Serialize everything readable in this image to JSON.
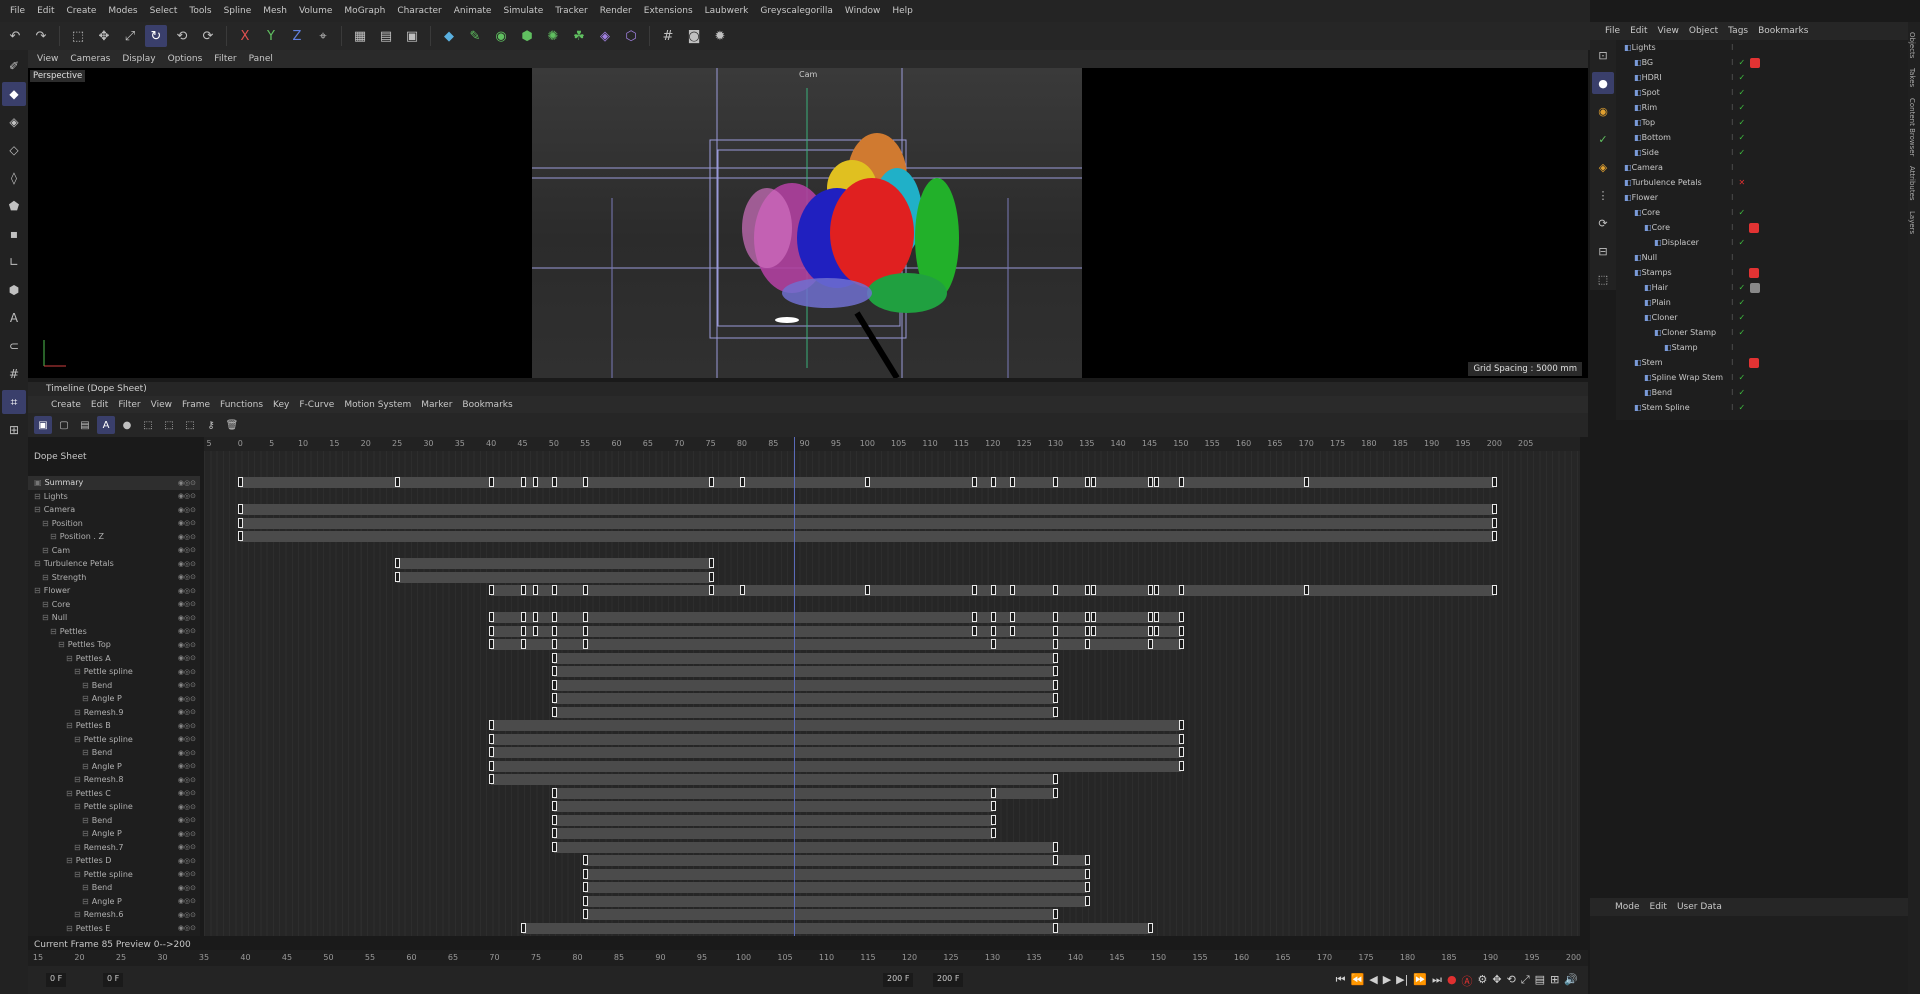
{
  "menu": [
    "File",
    "Edit",
    "Create",
    "Modes",
    "Select",
    "Tools",
    "Spline",
    "Mesh",
    "Volume",
    "MoGraph",
    "Character",
    "Animate",
    "Simulate",
    "Tracker",
    "Render",
    "Extensions",
    "Laubwerk",
    "Greyscalegorilla",
    "Window",
    "Help"
  ],
  "viewport": {
    "menu": [
      "View",
      "Cameras",
      "Display",
      "Options",
      "Filter",
      "Panel"
    ],
    "label": "Perspective",
    "camera_label": "Cam",
    "grid_spacing": "Grid Spacing : 5000 mm"
  },
  "timeline": {
    "title": "Timeline (Dope Sheet)",
    "menu": [
      "Create",
      "Edit",
      "Filter",
      "View",
      "Frame",
      "Functions",
      "Key",
      "F-Curve",
      "Motion System",
      "Marker",
      "Bookmarks"
    ],
    "dope_sheet_label": "Dope Sheet",
    "ruler": [
      "5",
      "0",
      "5",
      "10",
      "15",
      "20",
      "25",
      "30",
      "35",
      "40",
      "45",
      "50",
      "55",
      "60",
      "65",
      "70",
      "75",
      "80",
      "85",
      "90",
      "95",
      "100",
      "105",
      "110",
      "115",
      "120",
      "125",
      "130",
      "135",
      "140",
      "145",
      "150",
      "155",
      "160",
      "165",
      "170",
      "175",
      "180",
      "185",
      "190",
      "195",
      "200",
      "205"
    ],
    "playhead_frame": "85",
    "tracks": [
      "Summary",
      "Lights",
      "Camera",
      "Position",
      "Position . Z",
      "Cam",
      "Turbulence Petals",
      "Strength",
      "Flower",
      "Core",
      "Null",
      "Pettles",
      "Pettles Top",
      "Pettles A",
      "Pettle spline",
      "Bend",
      "Angle P",
      "Remesh.9",
      "Pettles B",
      "Pettle spline",
      "Bend",
      "Angle P",
      "Remesh.8",
      "Pettles C",
      "Pettle spline",
      "Bend",
      "Angle P",
      "Remesh.7",
      "Pettles D",
      "Pettle spline",
      "Bend",
      "Angle P",
      "Remesh.6",
      "Pettles E"
    ],
    "current_frame_label": "Current Frame  85  Preview  0-->200",
    "bottom_ruler": [
      "15",
      "20",
      "25",
      "30",
      "35",
      "40",
      "45",
      "50",
      "55",
      "60",
      "65",
      "70",
      "75",
      "80",
      "85",
      "90",
      "95",
      "100",
      "105",
      "110",
      "115",
      "120",
      "125",
      "130",
      "135",
      "140",
      "145",
      "150",
      "155",
      "160",
      "165",
      "170",
      "175",
      "180",
      "185",
      "190",
      "195",
      "200"
    ],
    "frame_start": "0 F",
    "frame_start2": "0 F",
    "frame_end": "200 F",
    "frame_end2": "200 F"
  },
  "object_manager": {
    "menu": [
      "File",
      "Edit",
      "View",
      "Object",
      "Tags",
      "Bookmarks"
    ],
    "objects": [
      {
        "name": "Lights",
        "indent": 0,
        "check": false
      },
      {
        "name": "BG",
        "indent": 1,
        "check": true,
        "tag": "#e23333"
      },
      {
        "name": "HDRI",
        "indent": 1,
        "check": true
      },
      {
        "name": "Spot",
        "indent": 1,
        "check": true
      },
      {
        "name": "Rim",
        "indent": 1,
        "check": true
      },
      {
        "name": "Top",
        "indent": 1,
        "check": true
      },
      {
        "name": "Bottom",
        "indent": 1,
        "check": true
      },
      {
        "name": "Side",
        "indent": 1,
        "check": true
      },
      {
        "name": "Camera",
        "indent": 0,
        "check": false
      },
      {
        "name": "Turbulence Petals",
        "indent": 0,
        "check": false,
        "cross": true
      },
      {
        "name": "Flower",
        "indent": 0,
        "check": false
      },
      {
        "name": "Core",
        "indent": 1,
        "check": true
      },
      {
        "name": "Core",
        "indent": 2,
        "check": false,
        "tag": "#e23333"
      },
      {
        "name": "Displacer",
        "indent": 3,
        "check": true
      },
      {
        "name": "Null",
        "indent": 1,
        "check": false
      },
      {
        "name": "Stamps",
        "indent": 1,
        "check": false,
        "tag": "#e23333"
      },
      {
        "name": "Hair",
        "indent": 2,
        "check": true,
        "tag": "#888888"
      },
      {
        "name": "Plain",
        "indent": 2,
        "check": true
      },
      {
        "name": "Cloner",
        "indent": 2,
        "check": true
      },
      {
        "name": "Cloner Stamp",
        "indent": 3,
        "check": true
      },
      {
        "name": "Stamp",
        "indent": 4,
        "check": false
      },
      {
        "name": "Stem",
        "indent": 1,
        "check": false,
        "tag": "#e23333"
      },
      {
        "name": "Spline Wrap Stem",
        "indent": 2,
        "check": true
      },
      {
        "name": "Bend",
        "indent": 2,
        "check": true
      },
      {
        "name": "Stem Spline",
        "indent": 1,
        "check": true
      }
    ]
  },
  "attributes": {
    "menu": [
      "Mode",
      "Edit",
      "User Data"
    ]
  },
  "side_tabs": [
    "Objects",
    "Takes",
    "Content Browser",
    "Attributes",
    "Layers"
  ],
  "colors": {
    "accent": "#5a6ab8",
    "key": "#e8e8e8",
    "check": "#3fbf3f"
  }
}
